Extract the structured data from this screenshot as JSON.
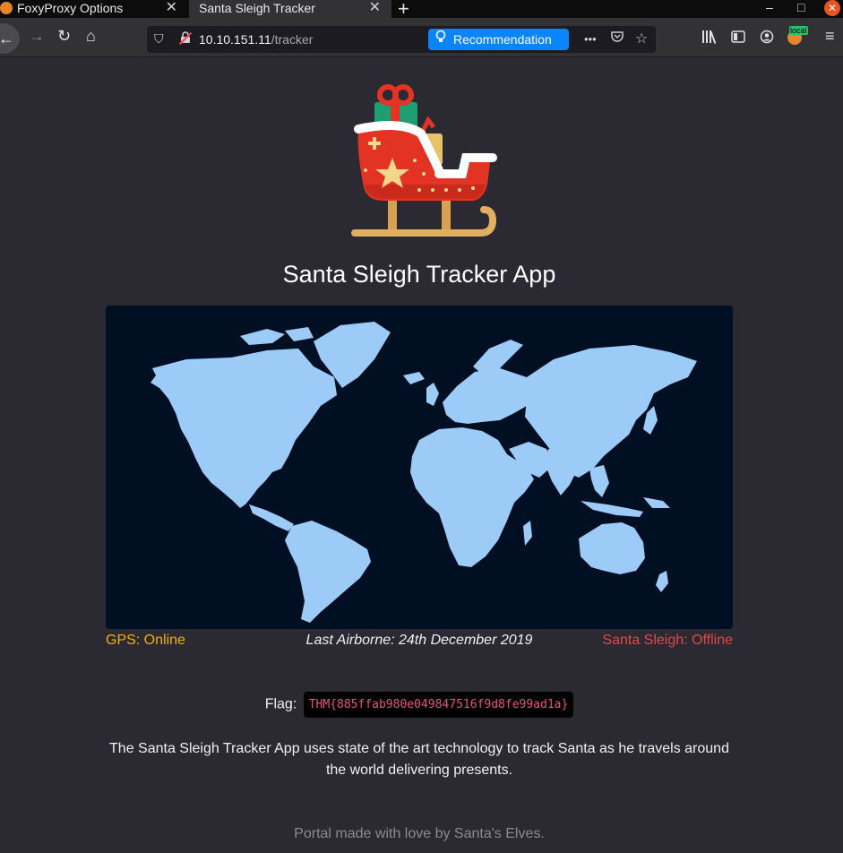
{
  "browser": {
    "tabs": [
      {
        "title": "FoxyProxy Options",
        "active": false
      },
      {
        "title": "Santa Sleigh Tracker",
        "active": true
      }
    ],
    "url_host": "10.10.151.11",
    "url_path": "/tracker",
    "recommendation_label": "Recommendation",
    "extension_badge": "local",
    "icons": {
      "tab_close": "✕",
      "new_tab": "+",
      "minimize": "–",
      "maximize": "□",
      "close": "✕",
      "back": "←",
      "forward": "→",
      "reload": "↻",
      "home": "⌂",
      "shield": "⛉",
      "lock": "🔒",
      "bulb": "💡",
      "more": "•••",
      "pocket": "◡",
      "star": "☆",
      "library": "|||\\",
      "sidebar": "▥",
      "account": "◉",
      "menu": "≡"
    }
  },
  "page": {
    "title": "Santa Sleigh Tracker App",
    "gps_status": "GPS: Online",
    "last_airborne": "Last Airborne: 24th December 2019",
    "sleigh_status": "Santa Sleigh: Offline",
    "flag_label": "Flag:",
    "flag_value": "THM{885ffab980e049847516f9d8fe99ad1a}",
    "description": "The Santa Sleigh Tracker App uses state of the art technology to track Santa as he travels around the world delivering presents.",
    "footer": "Portal made with love by Santa's Elves."
  },
  "colors": {
    "page_bg": "#2b2a33",
    "map_bg": "#010f22",
    "land": "#9ccbf8",
    "gps": "#f0b000",
    "offline": "#e04848",
    "flag_text": "#e8508a"
  }
}
